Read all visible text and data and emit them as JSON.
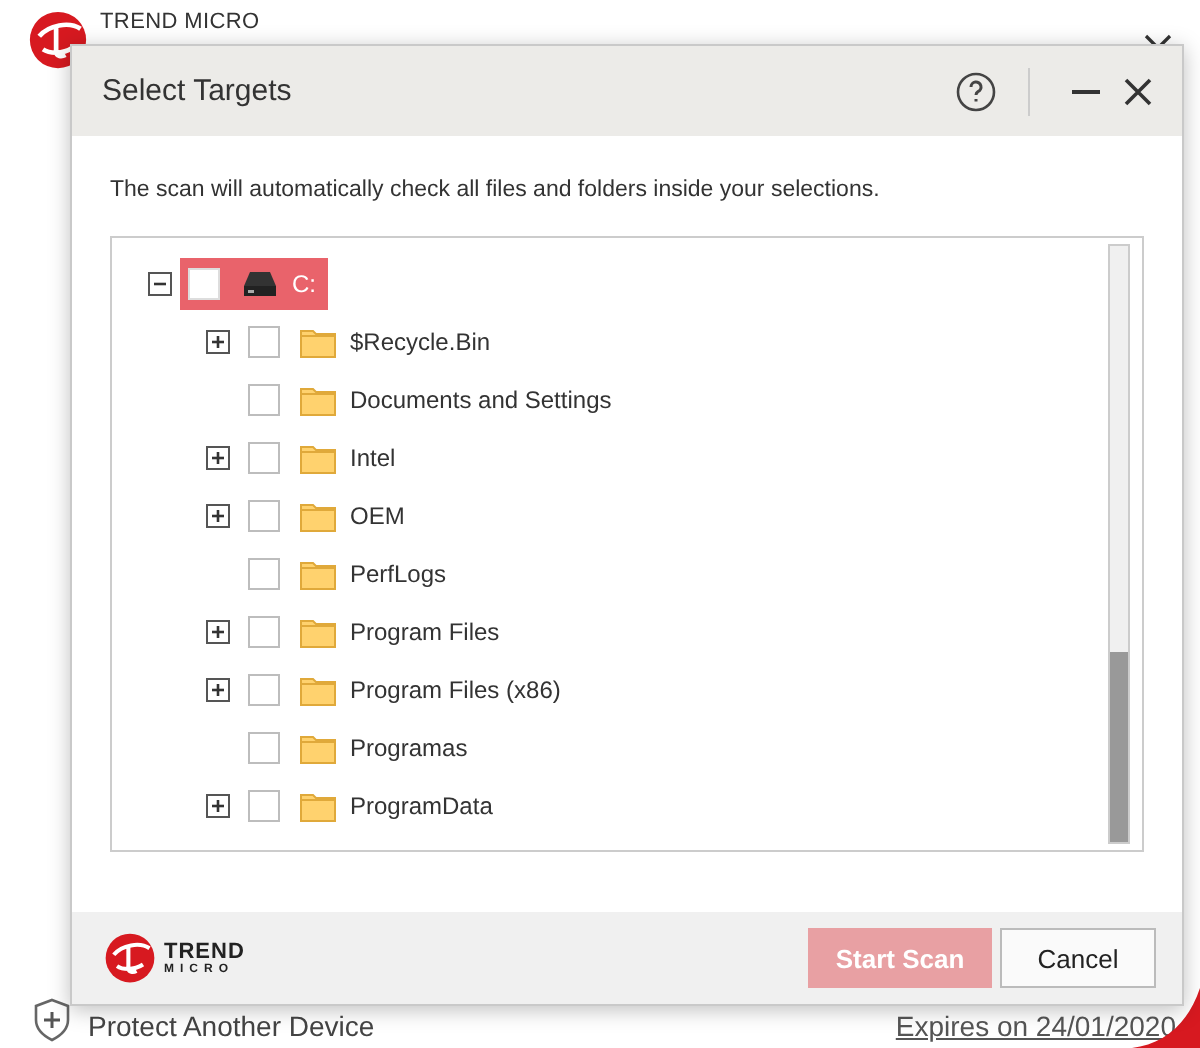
{
  "background": {
    "brand": "TREND MICRO",
    "protect_link": "Protect Another Device",
    "expires_link": "Expires on 24/01/2020"
  },
  "dialog": {
    "title": "Select Targets",
    "intro": "The scan will automatically check all files and folders inside your selections.",
    "tree": {
      "label": "C:",
      "selected": true,
      "checked": false,
      "expanded": true,
      "children": [
        {
          "label": "$Recycle.Bin",
          "checked": false,
          "kind": "expandable"
        },
        {
          "label": "Documents and Settings",
          "checked": false,
          "kind": "leaf"
        },
        {
          "label": "Intel",
          "checked": false,
          "kind": "expandable"
        },
        {
          "label": "OEM",
          "checked": false,
          "kind": "expandable"
        },
        {
          "label": "PerfLogs",
          "checked": false,
          "kind": "leaf"
        },
        {
          "label": "Program Files",
          "checked": false,
          "kind": "expandable"
        },
        {
          "label": "Program Files (x86)",
          "checked": false,
          "kind": "expandable"
        },
        {
          "label": "Programas",
          "checked": false,
          "kind": "leaf"
        },
        {
          "label": "ProgramData",
          "checked": false,
          "kind": "expandable"
        }
      ]
    },
    "footer_brand": {
      "line1": "TREND",
      "line2": "MICRO"
    },
    "buttons": [
      {
        "label": "Start Scan",
        "kind": "primary",
        "disabled": true
      },
      {
        "label": "Cancel",
        "kind": "secondary",
        "disabled": false
      }
    ]
  }
}
